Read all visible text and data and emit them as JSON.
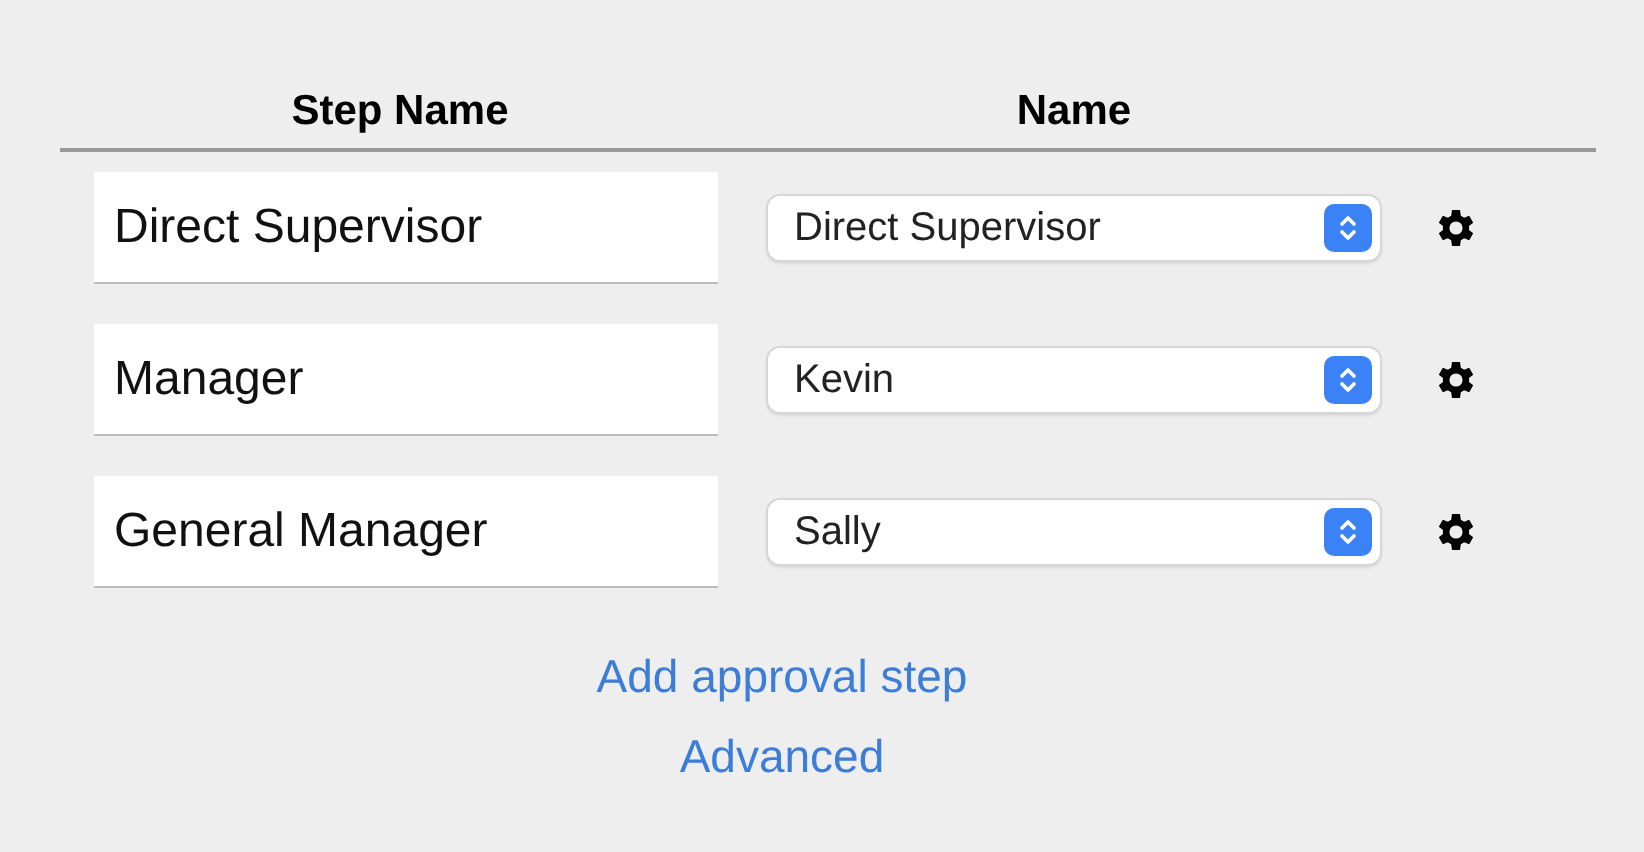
{
  "table": {
    "columns": [
      "Step Name",
      "Name"
    ],
    "rows": [
      {
        "step_name": "Direct Supervisor",
        "name": "Direct Supervisor"
      },
      {
        "step_name": "Manager",
        "name": "Kevin"
      },
      {
        "step_name": "General Manager",
        "name": "Sally"
      }
    ]
  },
  "links": [
    "Add approval step",
    "Advanced"
  ]
}
